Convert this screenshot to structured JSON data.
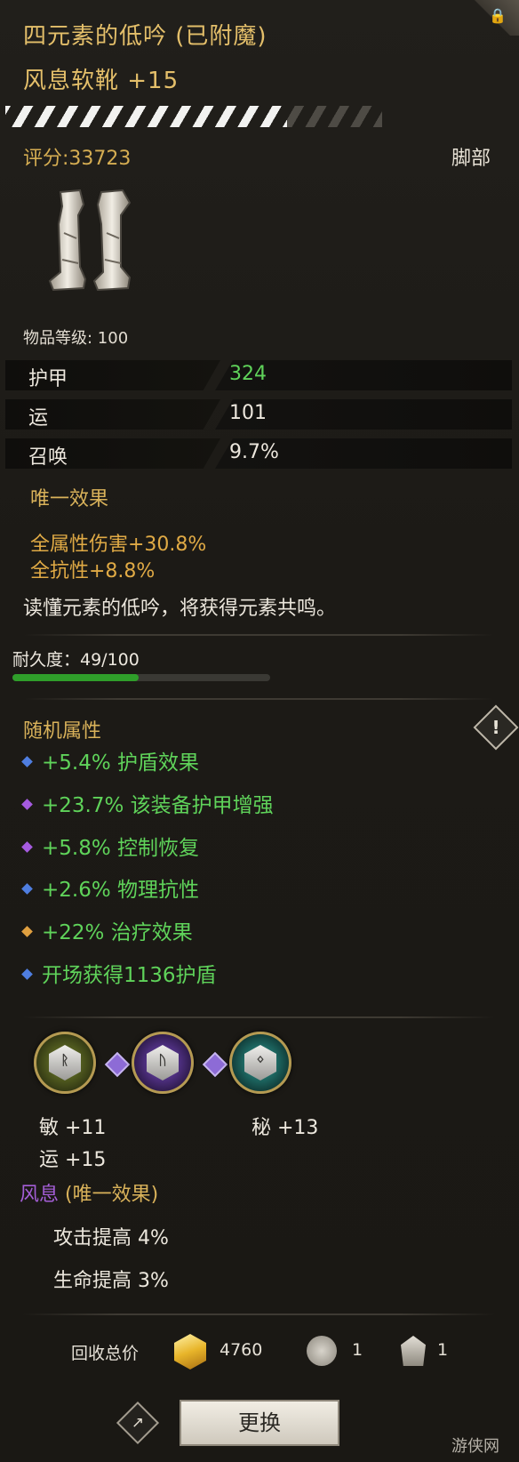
{
  "header": {
    "title_set": "四元素的低吟 (已附魔)",
    "item_name": "风息软靴 +15",
    "score": "评分:33723",
    "slot": "脚部",
    "quality_fill": 0.76
  },
  "item_level": "物品等级: 100",
  "stats": [
    {
      "name": "护甲",
      "value": "324",
      "color": "#5fd35a"
    },
    {
      "name": "运",
      "value": "101",
      "color": "#ece7dd"
    },
    {
      "name": "召唤",
      "value": "9.7%",
      "color": "#ece7dd"
    }
  ],
  "unique": {
    "title": "唯一效果",
    "lines": [
      "全属性伤害+30.8%",
      "全抗性+8.8%"
    ],
    "description": "读懂元素的低吟，将获得元素共鸣。"
  },
  "durability": {
    "label": "耐久度：49/100",
    "fraction": 0.49
  },
  "random": {
    "title": "随机属性",
    "warn_icon": "!",
    "affixes": [
      {
        "text": "+5.4% 护盾效果",
        "gem": "#4f7ee0"
      },
      {
        "text": "+23.7% 该装备护甲增强",
        "gem": "#a65be0"
      },
      {
        "text": "+5.8% 控制恢复",
        "gem": "#a65be0"
      },
      {
        "text": "+2.6% 物理抗性",
        "gem": "#4f7ee0"
      },
      {
        "text": "+22% 治疗效果",
        "gem": "#e0a040"
      },
      {
        "text": "开场获得1136护盾",
        "gem": "#4f7ee0"
      }
    ]
  },
  "sockets": {
    "glyphs": [
      "ᚱ",
      "ᚢ",
      "ᛜ"
    ],
    "stats": [
      "敏 +11",
      "秘 +13",
      "运 +15"
    ]
  },
  "set": {
    "name": "风息",
    "tag": " (唯一效果)",
    "name_color": "#a45ed6",
    "tag_color": "#d9b25a",
    "lines": [
      "攻击提高 4%",
      "生命提高 3%"
    ]
  },
  "recycle": {
    "label": "回收总价",
    "gold": "4760",
    "mat1_count": "1",
    "mat2_count": "1"
  },
  "actions": {
    "swap_label": "更换",
    "share_icon": "↗"
  },
  "watermark": "游侠网"
}
